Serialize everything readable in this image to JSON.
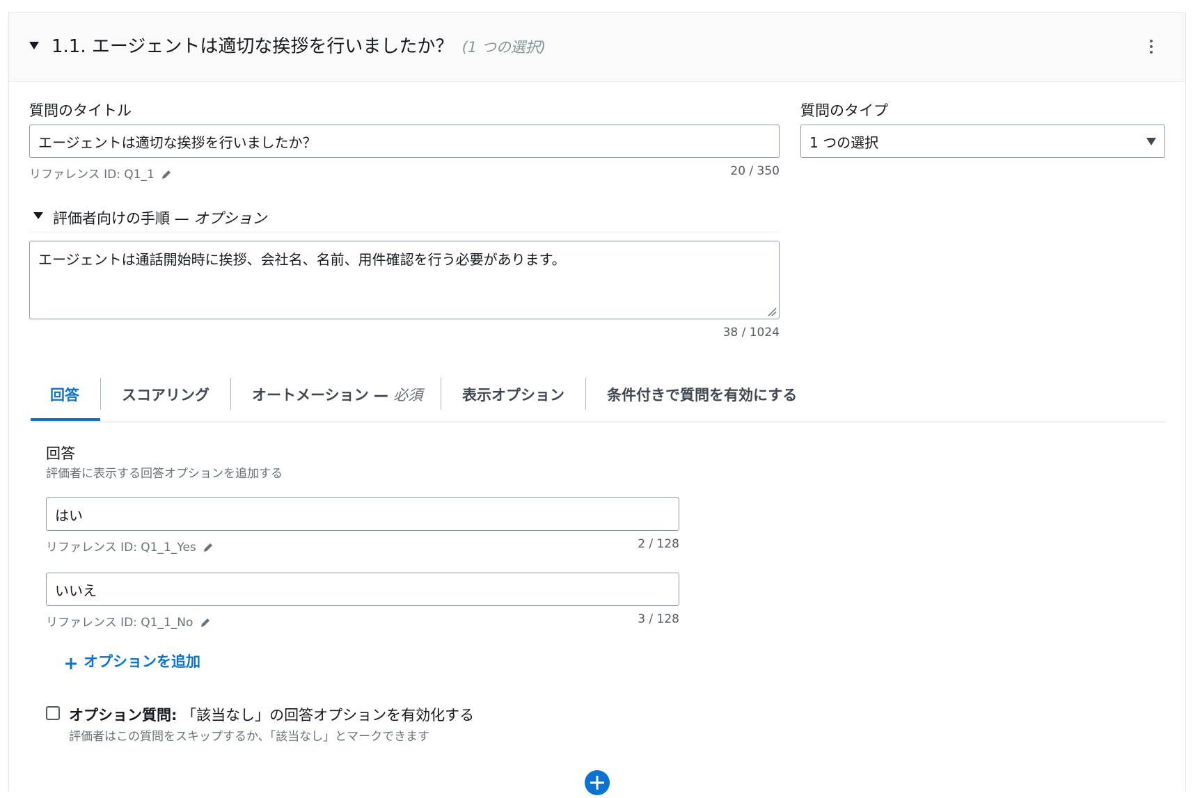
{
  "question": {
    "number": "1.1.",
    "title": "エージェントは適切な挨拶を行いましたか？",
    "type_note": "(1 つの選択)"
  },
  "title_field": {
    "label": "質問のタイトル",
    "value": "エージェントは適切な挨拶を行いましたか？",
    "ref": "リファレンス ID: Q1_1",
    "count": "20 / 350"
  },
  "type_field": {
    "label": "質問のタイプ",
    "value": "1 つの選択"
  },
  "instructions": {
    "label": "評価者向けの手順 —",
    "optional": "オプション",
    "value": "エージェントは通話開始時に挨拶、会社名、名前、用件確認を行う必要があります。",
    "count": "38 / 1024"
  },
  "tabs": [
    {
      "label": "回答"
    },
    {
      "label": "スコアリング"
    },
    {
      "label": "オートメーション —",
      "suffix": "必須"
    },
    {
      "label": "表示オプション"
    },
    {
      "label": "条件付きで質問を有効にする"
    }
  ],
  "answers": {
    "heading": "回答",
    "description": "評価者に表示する回答オプションを追加する",
    "options": [
      {
        "value": "はい",
        "ref": "リファレンス ID: Q1_1_Yes",
        "count": "2 / 128"
      },
      {
        "value": "いいえ",
        "ref": "リファレンス ID: Q1_1_No",
        "count": "3 / 128"
      }
    ],
    "add_label": "オプションを追加"
  },
  "optional_question": {
    "bold": "オプション質問:",
    "text": "「該当なし」の回答オプションを有効化する",
    "description": "評価者はこの質問をスキップするか、「該当なし」とマークできます"
  },
  "colors": {
    "accent": "#0972d3",
    "text": "#16191f",
    "muted": "#687078",
    "border": "#8d99a8"
  }
}
